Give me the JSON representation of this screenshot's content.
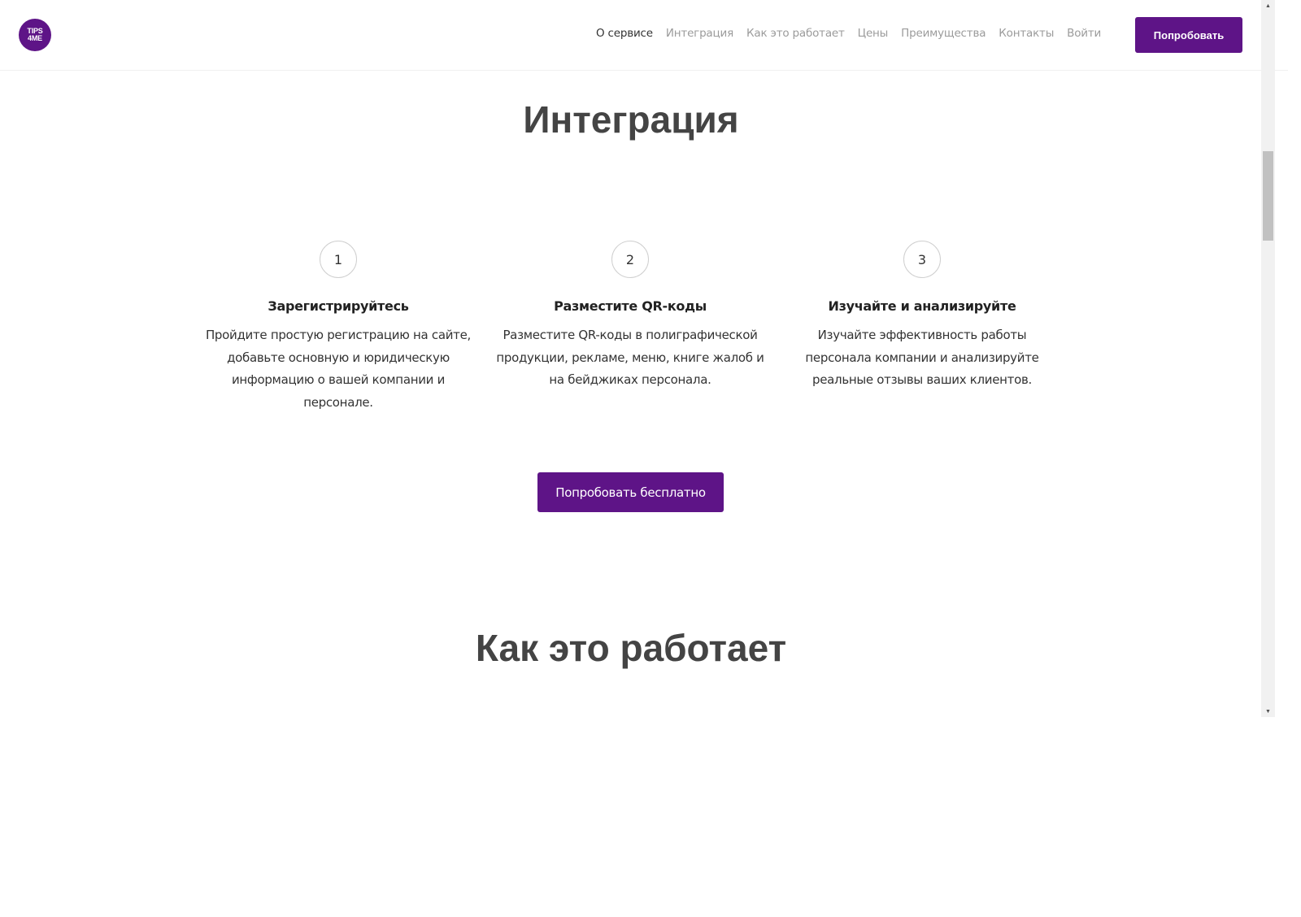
{
  "header": {
    "logo_line1": "TIPS",
    "logo_line2": "4ME",
    "nav": [
      {
        "label": "О сервисе"
      },
      {
        "label": "Интеграция"
      },
      {
        "label": "Как это работает"
      },
      {
        "label": "Цены"
      },
      {
        "label": "Преимущества"
      },
      {
        "label": "Контакты"
      },
      {
        "label": "Войти"
      }
    ],
    "cta_label": "Попробовать"
  },
  "integration": {
    "title": "Интеграция",
    "steps": [
      {
        "number": "1",
        "title": "Зарегистрируйтесь",
        "text": "Пройдите простую регистрацию на сайте, добавьте основную и юридическую информацию о вашей компании и персонале."
      },
      {
        "number": "2",
        "title": "Разместите QR-коды",
        "text": "Разместите QR-коды в полиграфической продукции, рекламе, меню, книге жалоб и на бейджиках персонала."
      },
      {
        "number": "3",
        "title": "Изучайте и анализируйте",
        "text": "Изучайте эффективность работы персонала компании и анализируйте реальные отзывы ваших клиентов."
      }
    ],
    "cta_label": "Попробовать бесплатно"
  },
  "how_it_works": {
    "title": "Как это работает"
  },
  "colors": {
    "brand": "#5e1487",
    "heading": "#444444",
    "nav_inactive": "#9b9b9b"
  }
}
